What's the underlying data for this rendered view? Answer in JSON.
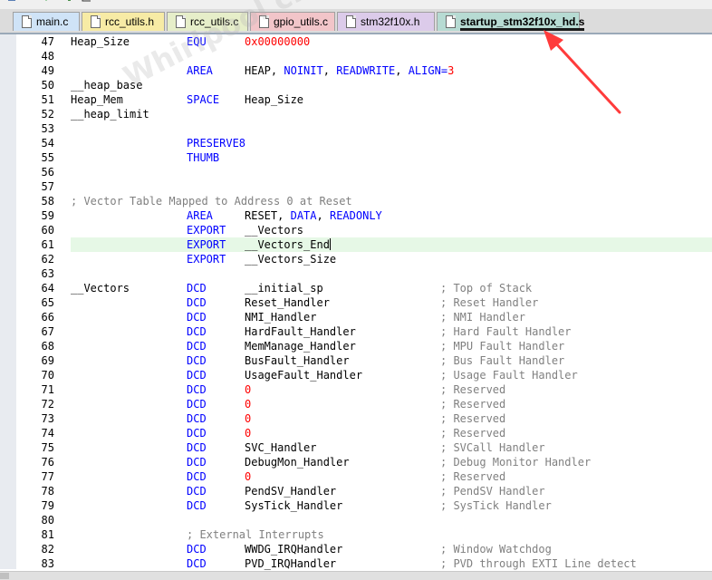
{
  "tabs": [
    {
      "label": "main.c",
      "bg": "#cfe3f7",
      "active": false
    },
    {
      "label": "rcc_utils.h",
      "bg": "#f7eba5",
      "active": false
    },
    {
      "label": "rcc_utils.c",
      "bg": "#e6eec9",
      "active": false
    },
    {
      "label": "gpio_utils.c",
      "bg": "#f2c5c9",
      "active": false
    },
    {
      "label": "stm32f10x.h",
      "bg": "#dccbea",
      "active": false
    },
    {
      "label": "startup_stm32f10x_hd.s",
      "bg": "#b7dbd3",
      "active": true
    }
  ],
  "watermark": "Whirlpool china  hsz661",
  "highlighted_line": 61,
  "code": [
    {
      "n": "47",
      "c1": "Heap_Size",
      "c2": "EQU",
      "c3": "0x00000000",
      "c4": "",
      "c3num": true
    },
    {
      "n": "48",
      "c1": "",
      "c2": "",
      "c3": "",
      "c4": ""
    },
    {
      "n": "49",
      "c1": "",
      "c2": "AREA",
      "c3": "HEAP, NOINIT, READWRITE, ALIGN=3",
      "c4": ""
    },
    {
      "n": "50",
      "c1": "__heap_base",
      "c2": "",
      "c3": "",
      "c4": ""
    },
    {
      "n": "51",
      "c1": "Heap_Mem",
      "c2": "SPACE",
      "c3": "Heap_Size",
      "c4": ""
    },
    {
      "n": "52",
      "c1": "__heap_limit",
      "c2": "",
      "c3": "",
      "c4": ""
    },
    {
      "n": "53",
      "c1": "",
      "c2": "",
      "c3": "",
      "c4": ""
    },
    {
      "n": "54",
      "c1": "",
      "c2": "PRESERVE8",
      "c3": "",
      "c4": ""
    },
    {
      "n": "55",
      "c1": "",
      "c2": "THUMB",
      "c3": "",
      "c4": ""
    },
    {
      "n": "56",
      "c1": "",
      "c2": "",
      "c3": "",
      "c4": ""
    },
    {
      "n": "57",
      "c1": "",
      "c2": "",
      "c3": "",
      "c4": ""
    },
    {
      "n": "58",
      "c1": "; Vector Table Mapped to Address 0 at Reset",
      "c2": "",
      "c3": "",
      "c4": "",
      "c1cmt": true
    },
    {
      "n": "59",
      "c1": "",
      "c2": "AREA",
      "c3": "RESET, DATA, READONLY",
      "c4": ""
    },
    {
      "n": "60",
      "c1": "",
      "c2": "EXPORT",
      "c3": "__Vectors",
      "c4": ""
    },
    {
      "n": "61",
      "c1": "",
      "c2": "EXPORT",
      "c3": "__Vectors_End",
      "c4": ""
    },
    {
      "n": "62",
      "c1": "",
      "c2": "EXPORT",
      "c3": "__Vectors_Size",
      "c4": ""
    },
    {
      "n": "63",
      "c1": "",
      "c2": "",
      "c3": "",
      "c4": ""
    },
    {
      "n": "64",
      "c1": "__Vectors",
      "c2": "DCD",
      "c3": "__initial_sp",
      "c4": "; Top of Stack"
    },
    {
      "n": "65",
      "c1": "",
      "c2": "DCD",
      "c3": "Reset_Handler",
      "c4": "; Reset Handler"
    },
    {
      "n": "66",
      "c1": "",
      "c2": "DCD",
      "c3": "NMI_Handler",
      "c4": "; NMI Handler"
    },
    {
      "n": "67",
      "c1": "",
      "c2": "DCD",
      "c3": "HardFault_Handler",
      "c4": "; Hard Fault Handler"
    },
    {
      "n": "68",
      "c1": "",
      "c2": "DCD",
      "c3": "MemManage_Handler",
      "c4": "; MPU Fault Handler"
    },
    {
      "n": "69",
      "c1": "",
      "c2": "DCD",
      "c3": "BusFault_Handler",
      "c4": "; Bus Fault Handler"
    },
    {
      "n": "70",
      "c1": "",
      "c2": "DCD",
      "c3": "UsageFault_Handler",
      "c4": "; Usage Fault Handler"
    },
    {
      "n": "71",
      "c1": "",
      "c2": "DCD",
      "c3": "0",
      "c4": "; Reserved",
      "c3num": true
    },
    {
      "n": "72",
      "c1": "",
      "c2": "DCD",
      "c3": "0",
      "c4": "; Reserved",
      "c3num": true
    },
    {
      "n": "73",
      "c1": "",
      "c2": "DCD",
      "c3": "0",
      "c4": "; Reserved",
      "c3num": true
    },
    {
      "n": "74",
      "c1": "",
      "c2": "DCD",
      "c3": "0",
      "c4": "; Reserved",
      "c3num": true
    },
    {
      "n": "75",
      "c1": "",
      "c2": "DCD",
      "c3": "SVC_Handler",
      "c4": "; SVCall Handler"
    },
    {
      "n": "76",
      "c1": "",
      "c2": "DCD",
      "c3": "DebugMon_Handler",
      "c4": "; Debug Monitor Handler"
    },
    {
      "n": "77",
      "c1": "",
      "c2": "DCD",
      "c3": "0",
      "c4": "; Reserved",
      "c3num": true
    },
    {
      "n": "78",
      "c1": "",
      "c2": "DCD",
      "c3": "PendSV_Handler",
      "c4": "; PendSV Handler"
    },
    {
      "n": "79",
      "c1": "",
      "c2": "DCD",
      "c3": "SysTick_Handler",
      "c4": "; SysTick Handler"
    },
    {
      "n": "80",
      "c1": "",
      "c2": "",
      "c3": "",
      "c4": ""
    },
    {
      "n": "81",
      "c1": "",
      "c2": "; External Interrupts",
      "c3": "",
      "c4": "",
      "c2cmt": true
    },
    {
      "n": "82",
      "c1": "",
      "c2": "DCD",
      "c3": "WWDG_IRQHandler",
      "c4": "; Window Watchdog"
    },
    {
      "n": "83",
      "c1": "",
      "c2": "DCD",
      "c3": "PVD_IRQHandler",
      "c4": "; PVD through EXTI Line detect"
    }
  ],
  "colors": {
    "keyword": "#0000ff",
    "number": "#ff0000",
    "comment": "#808080",
    "arrow": "#ff3b3b"
  }
}
